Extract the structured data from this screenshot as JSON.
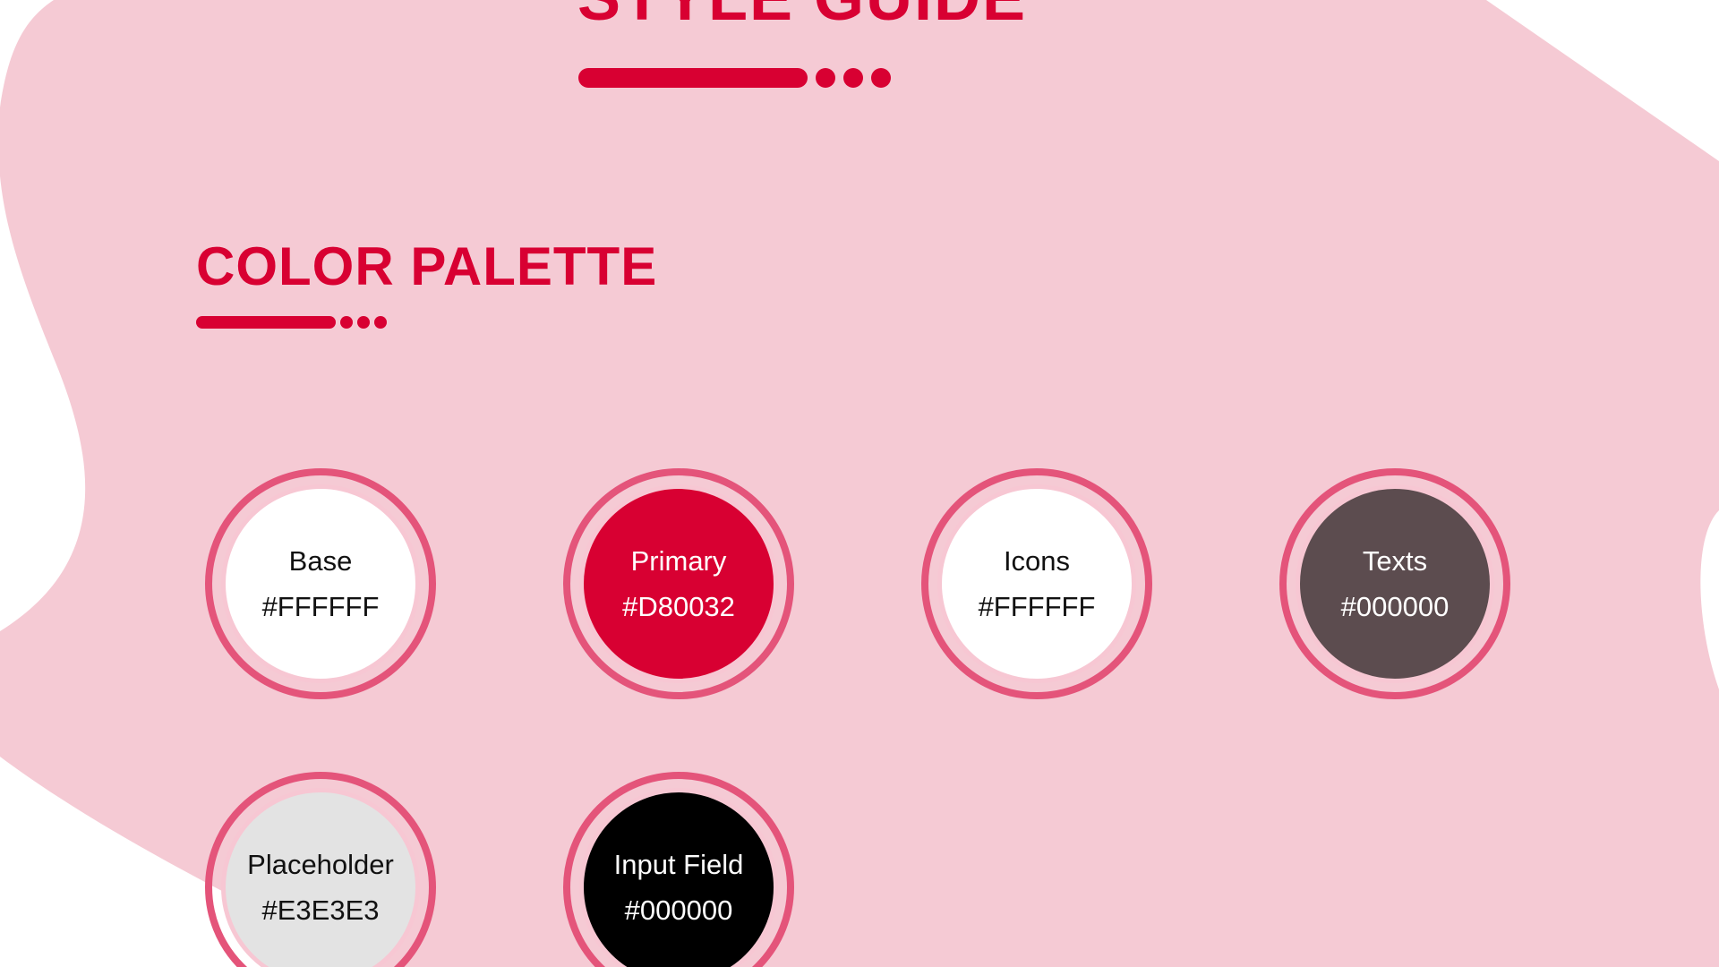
{
  "header": {
    "title": "STYLE GUIDE"
  },
  "section": {
    "title": "COLOR PALETTE"
  },
  "colors": {
    "accent": "#D80032",
    "blob": "#F5CAD4",
    "ring": "#E4547A",
    "ring_inner": "#F7C7D3"
  },
  "swatches": [
    {
      "name": "Base",
      "hex": "#FFFFFF",
      "fill": "#FFFFFF",
      "text_color": "#111111"
    },
    {
      "name": "Primary",
      "hex": "#D80032",
      "fill": "#D80032",
      "text_color": "#FFFFFF"
    },
    {
      "name": "Icons",
      "hex": "#FFFFFF",
      "fill": "#FFFFFF",
      "text_color": "#111111"
    },
    {
      "name": "Texts",
      "hex": "#000000",
      "fill": "#5C4C4F",
      "text_color": "#FFFFFF"
    },
    {
      "name": "Placeholder",
      "hex": "#E3E3E3",
      "fill": "#E3E3E3",
      "text_color": "#111111"
    },
    {
      "name": "Input Field",
      "hex": "#000000",
      "fill": "#000000",
      "text_color": "#FFFFFF"
    }
  ]
}
